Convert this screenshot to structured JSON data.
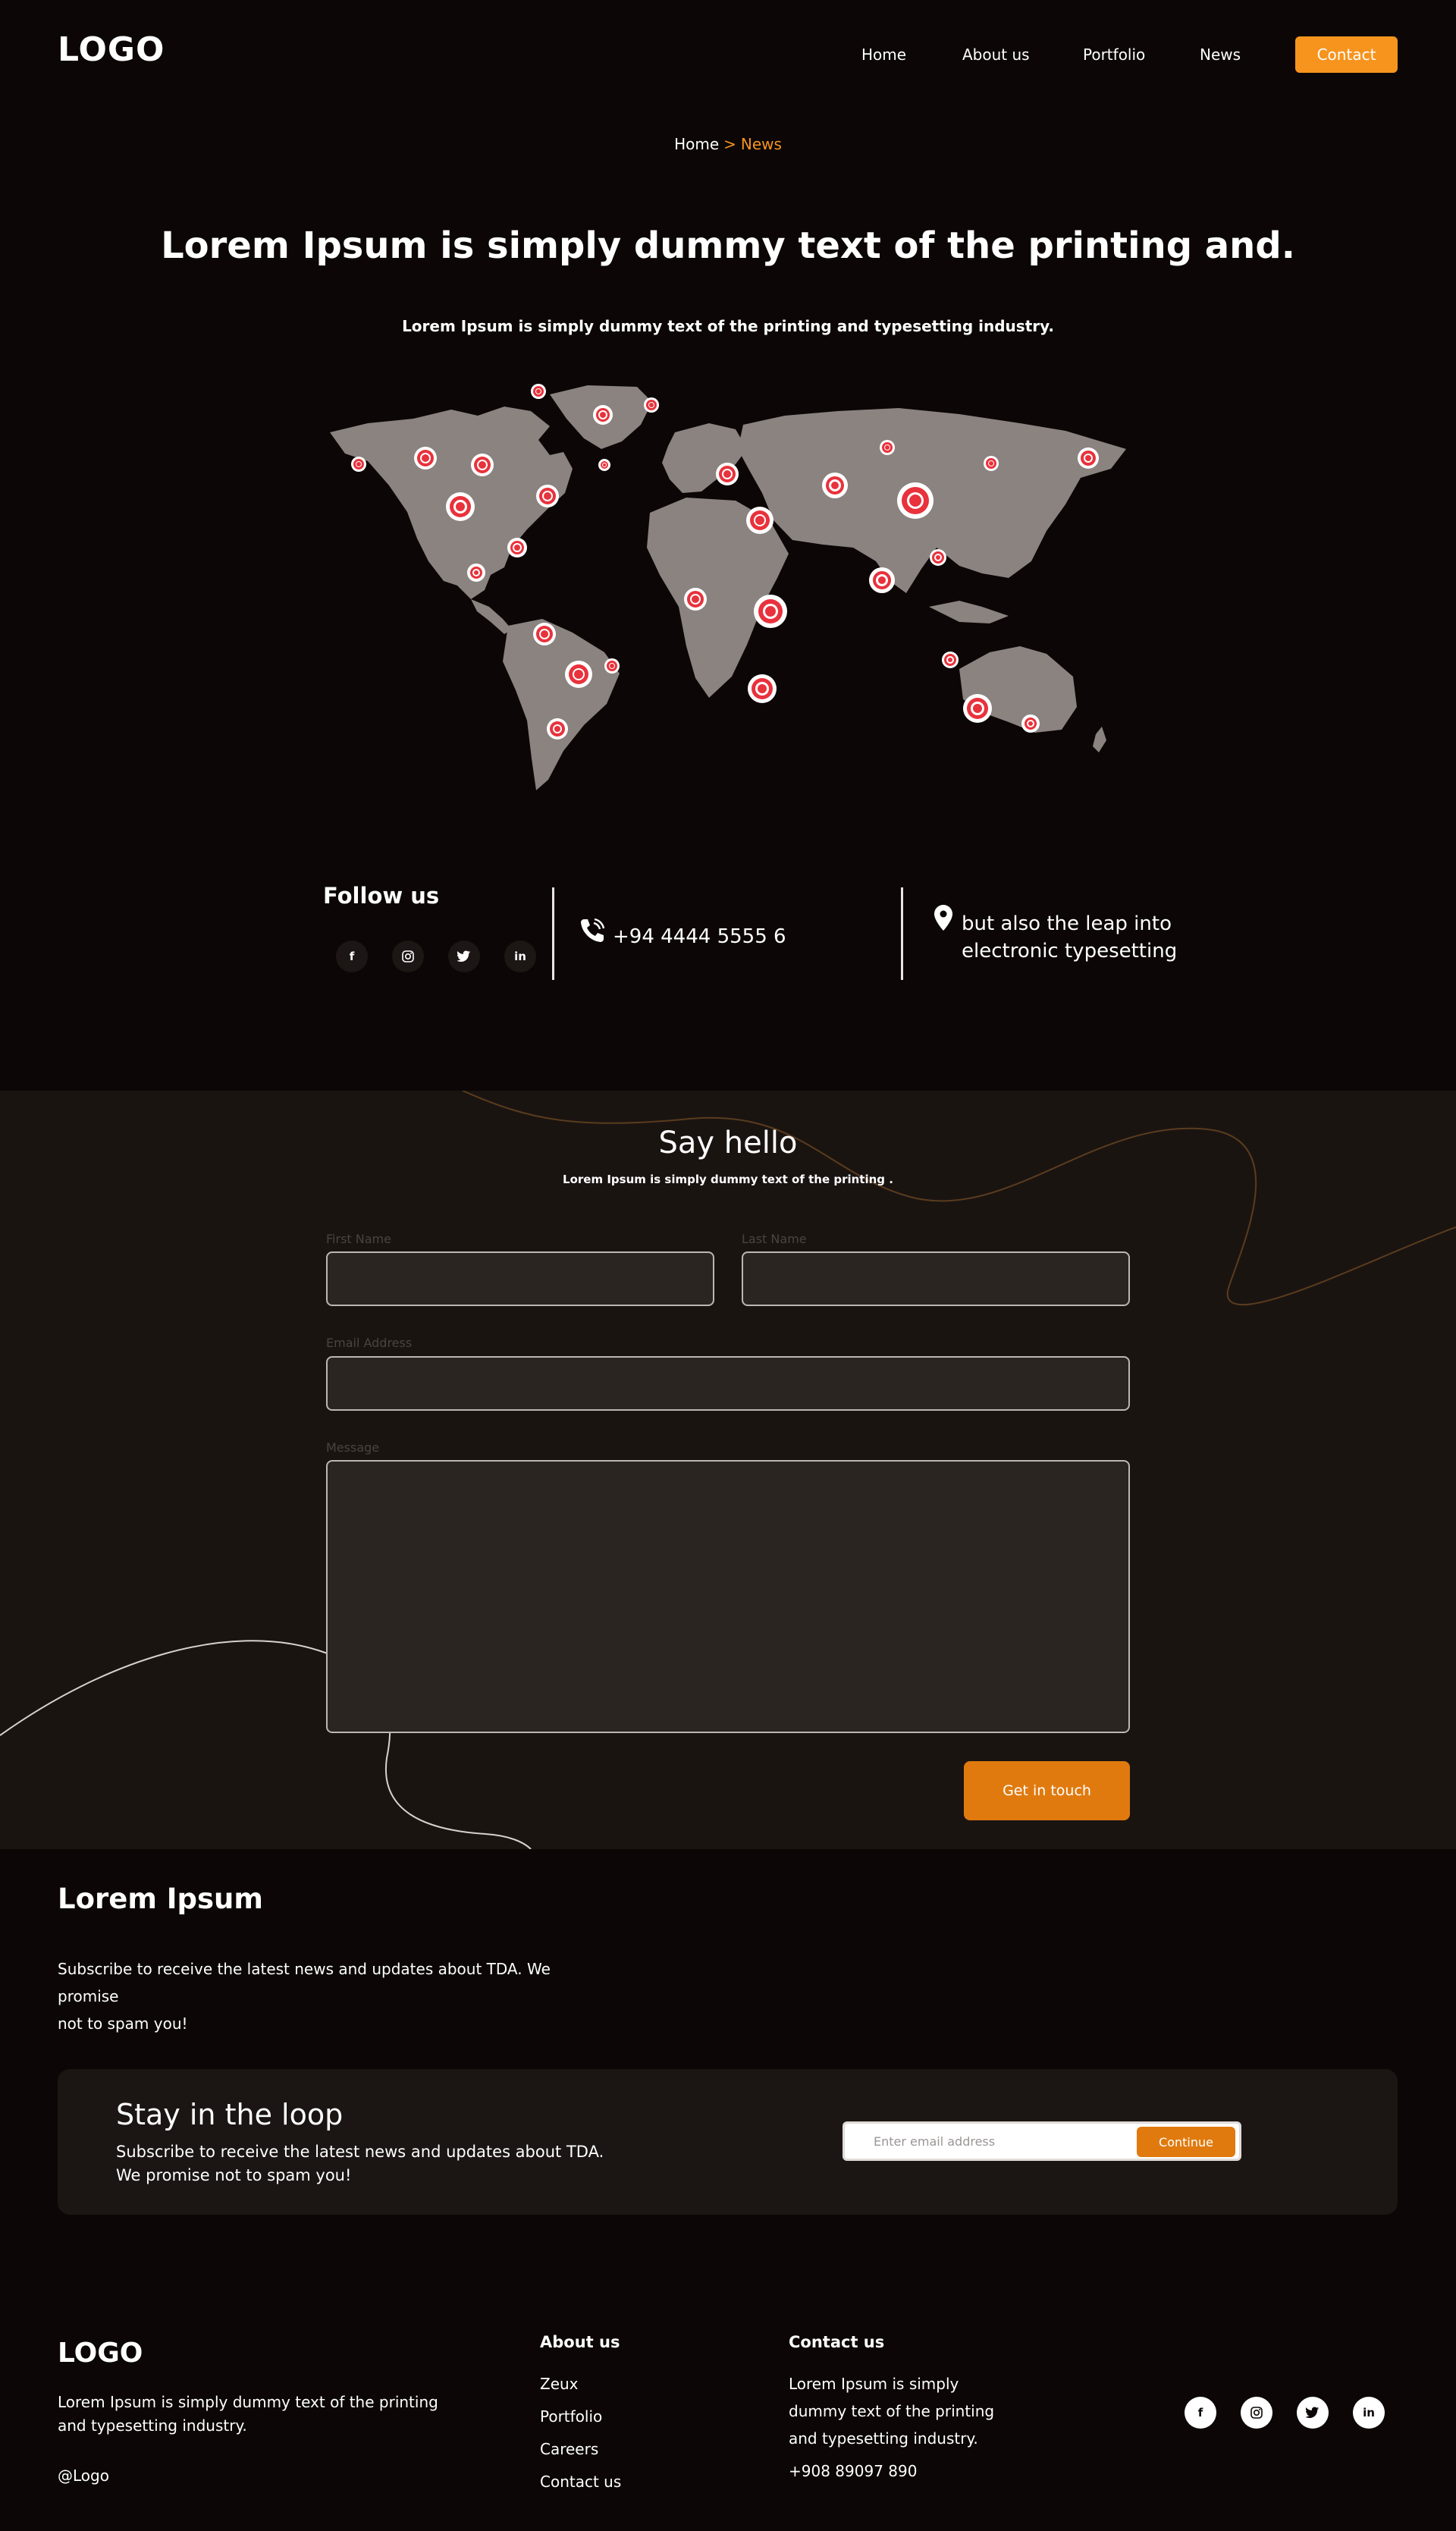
{
  "header": {
    "logo": "LOGO",
    "nav": [
      "Home",
      "About us",
      "Portfolio",
      "News"
    ],
    "contact": "Contact",
    "accent": "#f7941d"
  },
  "breadcrumb": {
    "home": "Home",
    "separator": ">",
    "current": "News"
  },
  "hero": {
    "title": "Lorem Ipsum is simply dummy text of the printing and.",
    "subtitle": "Lorem Ipsum is simply dummy text of the printing and typesetting industry."
  },
  "contact_info": {
    "follow": "Follow us",
    "socials": [
      "f",
      "ig",
      "t",
      "in"
    ],
    "phone": "+94 4444 5555 6",
    "address_line1": "but also the leap into",
    "address_line2": "electronic typesetting"
  },
  "form": {
    "title": "Say hello",
    "subtitle": "Lorem Ipsum is simply dummy text of the printing .",
    "first_name": "First Name",
    "last_name": "Last Name",
    "email": "Email Address",
    "message": "Message",
    "submit": "Get in touch"
  },
  "subscribe": {
    "title": "Lorem Ipsum",
    "line1": "Subscribe to receive the latest news and updates about TDA. We promise",
    "line2": "not to spam you!"
  },
  "loop": {
    "title": "Stay in the loop",
    "line1": "Subscribe to receive the latest news and updates about TDA.",
    "line2": "We promise not to spam you!",
    "placeholder": "Enter email address",
    "button": "Continue"
  },
  "footer": {
    "logo": "LOGO",
    "desc1": "Lorem Ipsum is simply dummy text of the printing",
    "desc2": "and typesetting industry.",
    "handle": "@Logo",
    "about_title": "About us",
    "about_links": [
      "Zeux",
      "Portfolio",
      "Careers",
      "Contact us"
    ],
    "contact_title": "Contact us",
    "contact_lines": [
      "Lorem Ipsum is simply",
      "dummy text of the printing",
      "and typesetting industry.",
      "+908 89097 890"
    ],
    "socials": [
      "f",
      "ig",
      "t",
      "in"
    ]
  }
}
